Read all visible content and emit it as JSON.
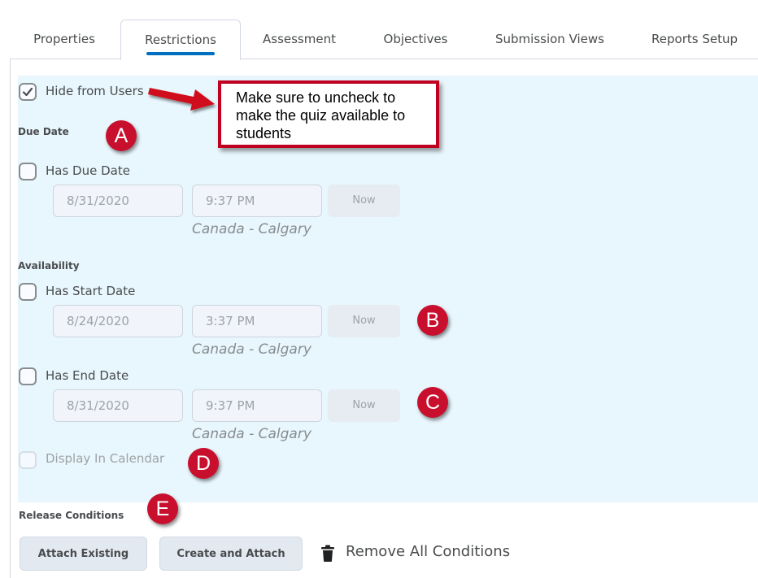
{
  "tabs": [
    {
      "label": "Properties"
    },
    {
      "label": "Restrictions",
      "active": true
    },
    {
      "label": "Assessment"
    },
    {
      "label": "Objectives"
    },
    {
      "label": "Submission Views"
    },
    {
      "label": "Reports Setup"
    }
  ],
  "hide_from_users": {
    "label": "Hide from Users",
    "checked": true
  },
  "callout": {
    "text": "Make sure to uncheck to make the quiz available to students"
  },
  "due_date": {
    "section_label": "Due Date",
    "checkbox_label": "Has Due Date",
    "checked": false,
    "date": "8/31/2020",
    "time": "9:37 PM",
    "now_label": "Now",
    "timezone": "Canada - Calgary"
  },
  "availability": {
    "section_label": "Availability",
    "start": {
      "checkbox_label": "Has Start Date",
      "checked": false,
      "date": "8/24/2020",
      "time": "3:37 PM",
      "now_label": "Now",
      "timezone": "Canada - Calgary"
    },
    "end": {
      "checkbox_label": "Has End Date",
      "checked": false,
      "date": "8/31/2020",
      "time": "9:37 PM",
      "now_label": "Now",
      "timezone": "Canada - Calgary"
    },
    "display_in_calendar": {
      "label": "Display In Calendar",
      "checked": false,
      "disabled": true
    }
  },
  "release_conditions": {
    "section_label": "Release Conditions",
    "attach_existing": "Attach Existing",
    "create_and_attach": "Create and Attach",
    "remove_all": "Remove All Conditions"
  },
  "markers": {
    "a": "A",
    "b": "B",
    "c": "C",
    "d": "D",
    "e": "E"
  },
  "colors": {
    "accent": "#006fbf",
    "panel_bg": "#e8f6fd",
    "marker": "#c8102e",
    "callout_border": "#c00020"
  }
}
